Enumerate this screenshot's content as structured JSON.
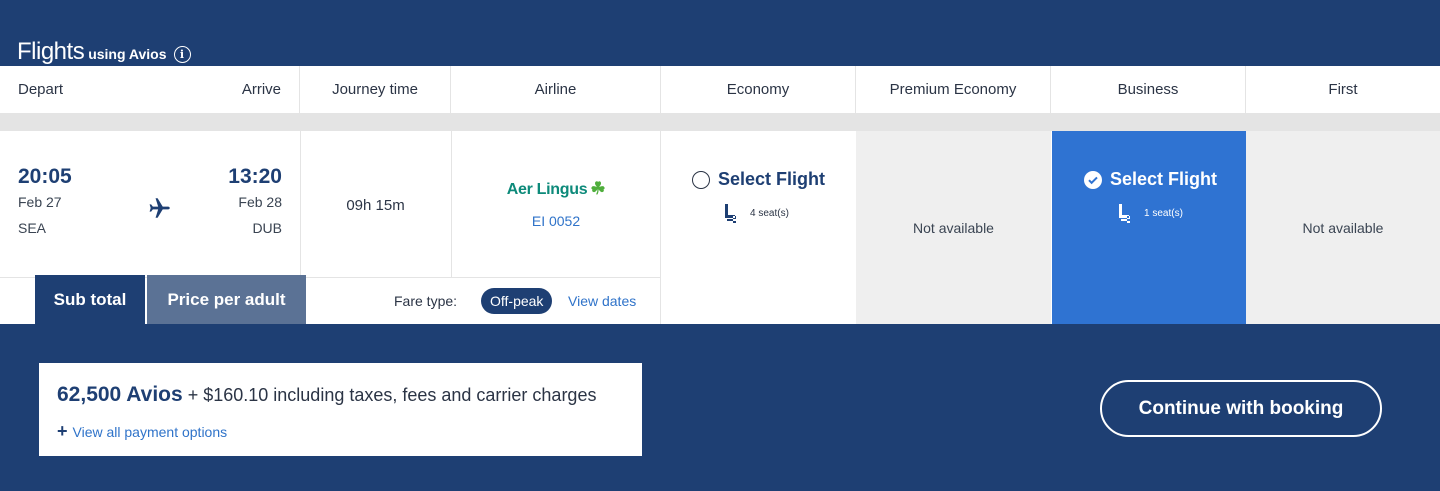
{
  "title": {
    "main": "Flights",
    "sub": "using Avios",
    "info_icon": "info-icon"
  },
  "columns": {
    "depart": "Depart",
    "arrive": "Arrive",
    "journey_time": "Journey time",
    "airline": "Airline",
    "economy": "Economy",
    "premium_economy": "Premium Economy",
    "business": "Business",
    "first": "First"
  },
  "flight": {
    "depart_time": "20:05",
    "depart_date": "Feb 27",
    "depart_airport": "SEA",
    "arrive_time": "13:20",
    "arrive_date": "Feb 28",
    "arrive_airport": "DUB",
    "duration": "09h 15m",
    "airline_name": "Aer Lingus",
    "flight_number": "EI 0052",
    "economy": {
      "label": "Select Flight",
      "seats": "4 seat(s)",
      "selected": false
    },
    "premium_economy": "Not available",
    "business": {
      "label": "Select Flight",
      "seats": "1 seat(s)",
      "selected": true
    },
    "first": "Not available"
  },
  "tabs": {
    "subtotal": "Sub total",
    "price_per_adult": "Price per adult"
  },
  "fare": {
    "label": "Fare type:",
    "value": "Off-peak",
    "view_dates": "View dates"
  },
  "price": {
    "avios": "62,500 Avios",
    "rest": " + $160.10 including taxes, fees and carrier charges",
    "view_payment": "View all payment options"
  },
  "continue_label": "Continue with booking",
  "colors": {
    "navy": "#1e3f73",
    "business_blue": "#2f73d2",
    "link": "#2f73c9",
    "aer_green": "#0d8a7a"
  }
}
